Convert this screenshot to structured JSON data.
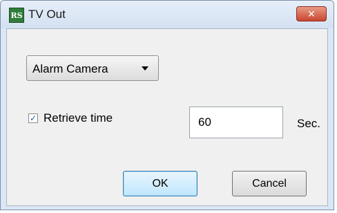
{
  "window": {
    "title": "TV Out",
    "app_icon_text": "RS",
    "close_glyph": "✕"
  },
  "dropdown": {
    "selected": "Alarm Camera",
    "icon": "chevron-down-icon"
  },
  "retrieve": {
    "checkbox_label": "Retrieve time",
    "checked": true,
    "check_glyph": "✓",
    "value": "60",
    "unit": "Sec."
  },
  "buttons": {
    "ok": "OK",
    "cancel": "Cancel"
  },
  "colors": {
    "close_button": "#c9452f",
    "ok_button_border": "#3c7fb1",
    "checkmark": "#2b5ea7"
  }
}
